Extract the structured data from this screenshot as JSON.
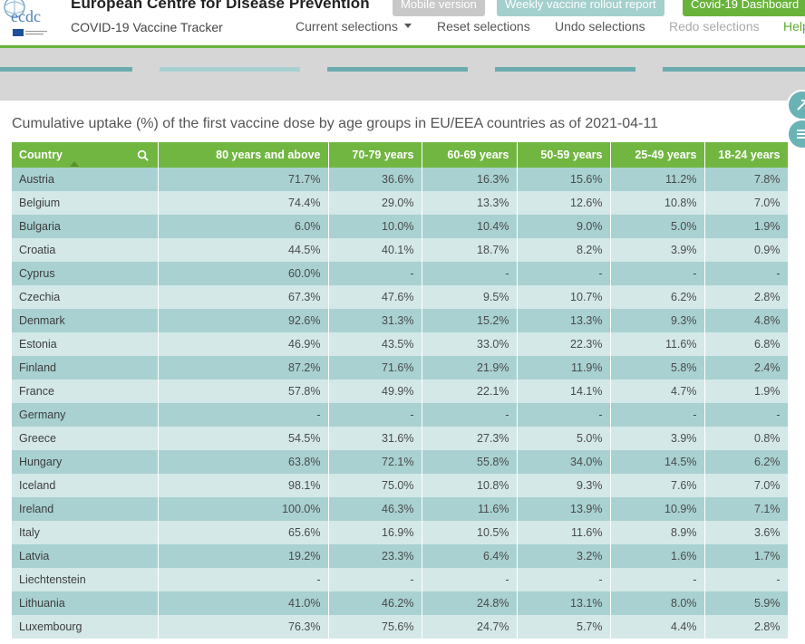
{
  "header": {
    "site_title": "European Centre for Disease Prevention",
    "app_subtitle": "COVID-19 Vaccine Tracker",
    "buttons": {
      "mobile": "Mobile version",
      "weekly": "Weekly vaccine rollout report",
      "dashboard": "Covid-19 Dashboard"
    },
    "menu": {
      "current": "Current selections",
      "reset": "Reset selections",
      "undo": "Undo selections",
      "redo": "Redo selections",
      "help": "Help"
    },
    "logo_text": "ecdc"
  },
  "colors": {
    "accent_green": "#69b33a",
    "header_green": "#72b642",
    "row_dark": "#a9d1d1",
    "row_light": "#d4e8e8",
    "teal_stub": "#6aacb0",
    "teal_stub_light": "#a8cfd1"
  },
  "side_icons": [
    "expand-icon",
    "menu-icon"
  ],
  "table": {
    "title": "Cumulative uptake (%) of the first vaccine dose by age groups in EU/EEA countries as of 2021-04-11",
    "columns": [
      "Country",
      "80 years and above",
      "70-79 years",
      "60-69 years",
      "50-59 years",
      "25-49 years",
      "18-24 years"
    ],
    "rows": [
      [
        "Austria",
        "71.7%",
        "36.6%",
        "16.3%",
        "15.6%",
        "11.2%",
        "7.8%"
      ],
      [
        "Belgium",
        "74.4%",
        "29.0%",
        "13.3%",
        "12.6%",
        "10.8%",
        "7.0%"
      ],
      [
        "Bulgaria",
        "6.0%",
        "10.0%",
        "10.4%",
        "9.0%",
        "5.0%",
        "1.9%"
      ],
      [
        "Croatia",
        "44.5%",
        "40.1%",
        "18.7%",
        "8.2%",
        "3.9%",
        "0.9%"
      ],
      [
        "Cyprus",
        "60.0%",
        "-",
        "-",
        "-",
        "-",
        "-"
      ],
      [
        "Czechia",
        "67.3%",
        "47.6%",
        "9.5%",
        "10.7%",
        "6.2%",
        "2.8%"
      ],
      [
        "Denmark",
        "92.6%",
        "31.3%",
        "15.2%",
        "13.3%",
        "9.3%",
        "4.8%"
      ],
      [
        "Estonia",
        "46.9%",
        "43.5%",
        "33.0%",
        "22.3%",
        "11.6%",
        "6.8%"
      ],
      [
        "Finland",
        "87.2%",
        "71.6%",
        "21.9%",
        "11.9%",
        "5.8%",
        "2.4%"
      ],
      [
        "France",
        "57.8%",
        "49.9%",
        "22.1%",
        "14.1%",
        "4.7%",
        "1.9%"
      ],
      [
        "Germany",
        "-",
        "-",
        "-",
        "-",
        "-",
        "-"
      ],
      [
        "Greece",
        "54.5%",
        "31.6%",
        "27.3%",
        "5.0%",
        "3.9%",
        "0.8%"
      ],
      [
        "Hungary",
        "63.8%",
        "72.1%",
        "55.8%",
        "34.0%",
        "14.5%",
        "6.2%"
      ],
      [
        "Iceland",
        "98.1%",
        "75.0%",
        "10.8%",
        "9.3%",
        "7.6%",
        "7.0%"
      ],
      [
        "Ireland",
        "100.0%",
        "46.3%",
        "11.6%",
        "13.9%",
        "10.9%",
        "7.1%"
      ],
      [
        "Italy",
        "65.6%",
        "16.9%",
        "10.5%",
        "11.6%",
        "8.9%",
        "3.6%"
      ],
      [
        "Latvia",
        "19.2%",
        "23.3%",
        "6.4%",
        "3.2%",
        "1.6%",
        "1.7%"
      ],
      [
        "Liechtenstein",
        "-",
        "-",
        "-",
        "-",
        "-",
        "-"
      ],
      [
        "Lithuania",
        "41.0%",
        "46.2%",
        "24.8%",
        "13.1%",
        "8.0%",
        "5.9%"
      ],
      [
        "Luxembourg",
        "76.3%",
        "75.6%",
        "24.7%",
        "5.7%",
        "4.4%",
        "2.8%"
      ]
    ]
  }
}
